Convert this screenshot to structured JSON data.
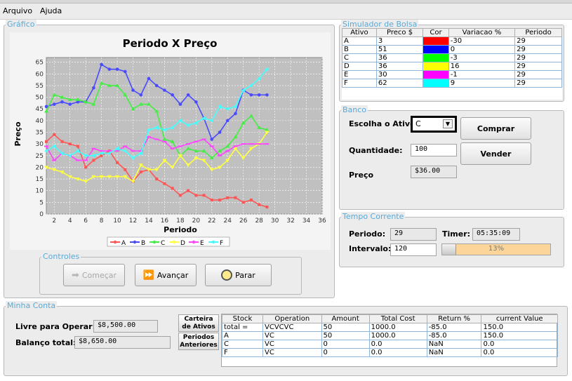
{
  "menu": {
    "items": [
      "Arquivo",
      "Ajuda"
    ]
  },
  "grafico": {
    "panel_title": "Gráfico",
    "chart_data": {
      "type": "line",
      "title": "Periodo X Preço",
      "xlabel": "Periodo",
      "ylabel": "Preço",
      "xlim": [
        1,
        36
      ],
      "ylim": [
        0,
        67
      ],
      "x_ticks": [
        2,
        4,
        6,
        8,
        10,
        12,
        14,
        16,
        18,
        20,
        22,
        24,
        26,
        28,
        30,
        32,
        34,
        36
      ],
      "y_ticks": [
        0,
        5,
        10,
        15,
        20,
        25,
        30,
        35,
        40,
        45,
        50,
        55,
        60,
        65
      ],
      "grid": true,
      "legend_position": "bottom",
      "x": [
        1,
        2,
        3,
        4,
        5,
        6,
        7,
        8,
        9,
        10,
        11,
        12,
        13,
        14,
        15,
        16,
        17,
        18,
        19,
        20,
        21,
        22,
        23,
        24,
        25,
        26,
        27,
        28,
        29
      ],
      "series": [
        {
          "name": "A",
          "color": "#ff5555",
          "values": [
            31,
            34,
            31,
            30,
            29,
            20,
            23,
            25,
            27,
            22,
            19,
            14,
            18,
            19,
            15,
            13,
            11,
            8,
            10,
            8,
            8,
            6,
            6,
            7,
            7,
            5,
            6,
            4,
            3
          ]
        },
        {
          "name": "B",
          "color": "#4a4aff",
          "values": [
            46,
            47,
            48,
            47,
            48,
            48,
            54,
            64,
            62,
            62,
            61,
            53,
            51,
            58,
            55,
            53,
            51,
            47,
            51,
            48,
            41,
            32,
            35,
            40,
            43,
            53,
            51,
            51,
            51
          ]
        },
        {
          "name": "C",
          "color": "#44ee44",
          "values": [
            44,
            51,
            50,
            49,
            49,
            48,
            47,
            56,
            55,
            55,
            51,
            45,
            47,
            47,
            44,
            32,
            31,
            25,
            28,
            27,
            27,
            24,
            27,
            29,
            33,
            39,
            42,
            37,
            36
          ]
        },
        {
          "name": "D",
          "color": "#ffff44",
          "values": [
            20,
            19,
            18,
            16,
            15,
            14,
            16,
            16,
            16,
            16,
            16,
            14,
            21,
            19,
            19,
            23,
            20,
            25,
            21,
            24,
            23,
            19,
            20,
            23,
            28,
            24,
            28,
            30,
            35
          ]
        },
        {
          "name": "E",
          "color": "#ff44ff",
          "values": [
            29,
            23,
            26,
            25,
            23,
            23,
            28,
            27,
            27,
            27,
            29,
            27,
            27,
            33,
            32,
            31,
            28,
            29,
            30,
            31,
            32,
            29,
            25,
            27,
            29,
            30,
            30,
            30,
            30
          ]
        },
        {
          "name": "F",
          "color": "#44ffff",
          "values": [
            27,
            29,
            26,
            25,
            27,
            25,
            25,
            26,
            26,
            28,
            27,
            24,
            26,
            36,
            37,
            36,
            37,
            40,
            38,
            39,
            41,
            40,
            46,
            45,
            46,
            53,
            55,
            58,
            62
          ]
        }
      ]
    }
  },
  "controles": {
    "title": "Controles",
    "start_label": "Começar",
    "advance_label": "Avançar",
    "stop_label": "Parar"
  },
  "simulador": {
    "title": "Simulador de Bolsa",
    "headers": [
      "Ativo",
      "Preco $",
      "Cor",
      "Variacao %",
      "Periodo"
    ],
    "rows": [
      {
        "ativo": "A",
        "preco": "3",
        "cor": "#ff0000",
        "variacao": "-30",
        "periodo": "29"
      },
      {
        "ativo": "B",
        "preco": "51",
        "cor": "#0000ff",
        "variacao": "0",
        "periodo": "29"
      },
      {
        "ativo": "C",
        "preco": "36",
        "cor": "#00ff00",
        "variacao": "-3",
        "periodo": "29"
      },
      {
        "ativo": "D",
        "preco": "36",
        "cor": "#ffff00",
        "variacao": "16",
        "periodo": "29"
      },
      {
        "ativo": "E",
        "preco": "30",
        "cor": "#ff00ff",
        "variacao": "-1",
        "periodo": "29"
      },
      {
        "ativo": "F",
        "preco": "62",
        "cor": "#00ffff",
        "variacao": "9",
        "periodo": "29"
      }
    ]
  },
  "banco": {
    "title": "Banco",
    "choose_label": "Escolha o Ativo:",
    "choose_value": "C",
    "buy_label": "Comprar",
    "qty_label": "Quantidade:",
    "qty_value": "100",
    "sell_label": "Vender",
    "price_label": "Preço",
    "price_value": "$36.00"
  },
  "tempo": {
    "title": "Tempo Corrente",
    "periodo_label": "Periodo:",
    "periodo_value": "29",
    "timer_label": "Timer:",
    "timer_value": "05:35:09",
    "intervalo_label": "Intervalo:",
    "intervalo_value": "120",
    "progress_text": "13%",
    "progress_fraction": 0.13
  },
  "conta": {
    "title": "Minha Conta",
    "livre_label": "Livre para Operar:",
    "livre_value": "$8,500.00",
    "balanco_label": "Balanço total:",
    "balanco_value": "$8,650.00",
    "tab1_label": "Carteira de Ativos",
    "tab2_label": "Periodos Anteriores",
    "headers": [
      "Stock",
      "Operation",
      "Amount",
      "Total Cost",
      "Return %",
      "current Value"
    ],
    "rows": [
      [
        "total =",
        "VCVCVC",
        "50",
        "1000.0",
        "-85.0",
        "150.0"
      ],
      [
        "A",
        "VC",
        "50",
        "1000.0",
        "-85.0",
        "150.0"
      ],
      [
        "C",
        "VC",
        "0",
        "0.0",
        "NaN",
        "0.0"
      ],
      [
        "F",
        "VC",
        "0",
        "0.0",
        "NaN",
        "0.0"
      ]
    ]
  }
}
